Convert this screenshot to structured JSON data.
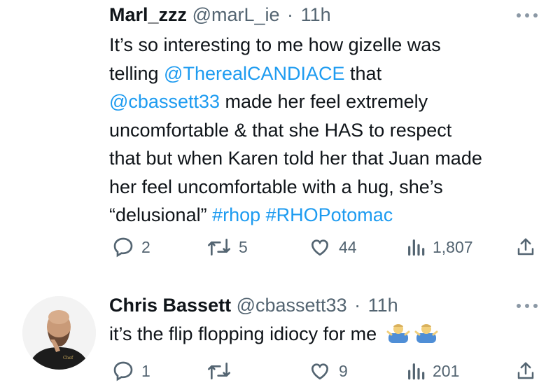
{
  "tweets": [
    {
      "name": "Marl_zzz",
      "handle": "@marL_ie",
      "dot": "·",
      "time": "11h",
      "text_parts": [
        {
          "t": "It’s so interesting to me how gizelle was\ntelling "
        },
        {
          "t": "@TherealCANDIACE",
          "link": true
        },
        {
          "t": " that\n"
        },
        {
          "t": "@cbassett33",
          "link": true
        },
        {
          "t": " made her feel extremely\nuncomfortable & that she HAS to respect\nthat but when Karen told her that Juan made\nher feel uncomfortable with a hug, she’s\n“delusional” "
        },
        {
          "t": "#rhop",
          "link": true
        },
        {
          "t": " "
        },
        {
          "t": "#RHOPotomac",
          "link": true
        }
      ],
      "replies": "2",
      "retweets": "5",
      "likes": "44",
      "views": "1,807"
    },
    {
      "name": "Chris Bassett",
      "handle": "@cbassett33",
      "dot": "·",
      "time": "11h",
      "text_parts": [
        {
          "t": "it’s the flip flopping idiocy for me"
        }
      ],
      "emojis": [
        "person-shrugging-emoji",
        "person-shrugging-emoji"
      ],
      "replies": "1",
      "retweets": "",
      "likes": "9",
      "views": "201"
    }
  ],
  "colors": {
    "link": "#1d9bf0",
    "muted": "#536471",
    "text": "#0f1419"
  },
  "icons": [
    "more-icon",
    "reply-icon",
    "retweet-icon",
    "like-icon",
    "views-icon",
    "share-icon"
  ]
}
